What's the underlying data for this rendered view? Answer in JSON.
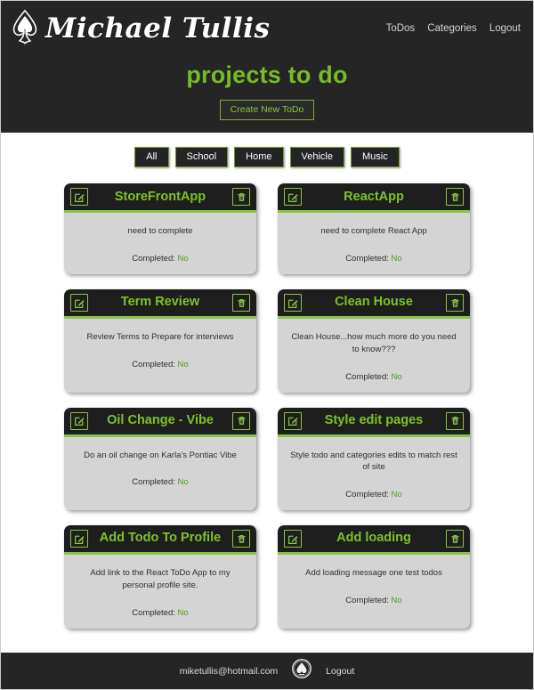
{
  "header": {
    "brand_name": "Michael Tullis",
    "brand_icon": "spade-emblem-icon",
    "nav": [
      {
        "label": "ToDos"
      },
      {
        "label": "Categories"
      },
      {
        "label": "Logout"
      }
    ],
    "page_title": "projects to do",
    "create_button": "Create New ToDo"
  },
  "filters": [
    {
      "label": "All",
      "active": true
    },
    {
      "label": "School",
      "active": false
    },
    {
      "label": "Home",
      "active": false
    },
    {
      "label": "Vehicle",
      "active": false
    },
    {
      "label": "Music",
      "active": false
    }
  ],
  "card_icons": {
    "edit": "edit-pencil-icon",
    "delete": "trash-icon"
  },
  "status_label": "Completed:",
  "todos": [
    {
      "title": "StoreFrontApp",
      "description": "need to complete",
      "completed": "No"
    },
    {
      "title": "ReactApp",
      "description": "need to complete React App",
      "completed": "No"
    },
    {
      "title": "Term Review",
      "description": "Review Terms to Prepare for interviews",
      "completed": "No"
    },
    {
      "title": "Clean House",
      "description": "Clean House...how much more do you need to know???",
      "completed": "No"
    },
    {
      "title": "Oil Change - Vibe",
      "description": "Do an oil change on Karla's Pontiac Vibe",
      "completed": "No"
    },
    {
      "title": "Style edit pages",
      "description": "Style todo and categories edits to match rest of site",
      "completed": "No"
    },
    {
      "title": "Add Todo To Profile",
      "description": "Add link to the React ToDo App to my personal profile site.",
      "completed": "No"
    },
    {
      "title": "Add loading",
      "description": "Add loading message one test todos",
      "completed": "No"
    }
  ],
  "footer": {
    "email": "miketullis@hotmail.com",
    "logo_icon": "spade-circle-icon",
    "logout_label": "Logout"
  },
  "colors": {
    "accent_green": "#8bc34a",
    "title_green": "#76bb28",
    "dark": "#252525",
    "card_body": "#d4d4d4"
  }
}
